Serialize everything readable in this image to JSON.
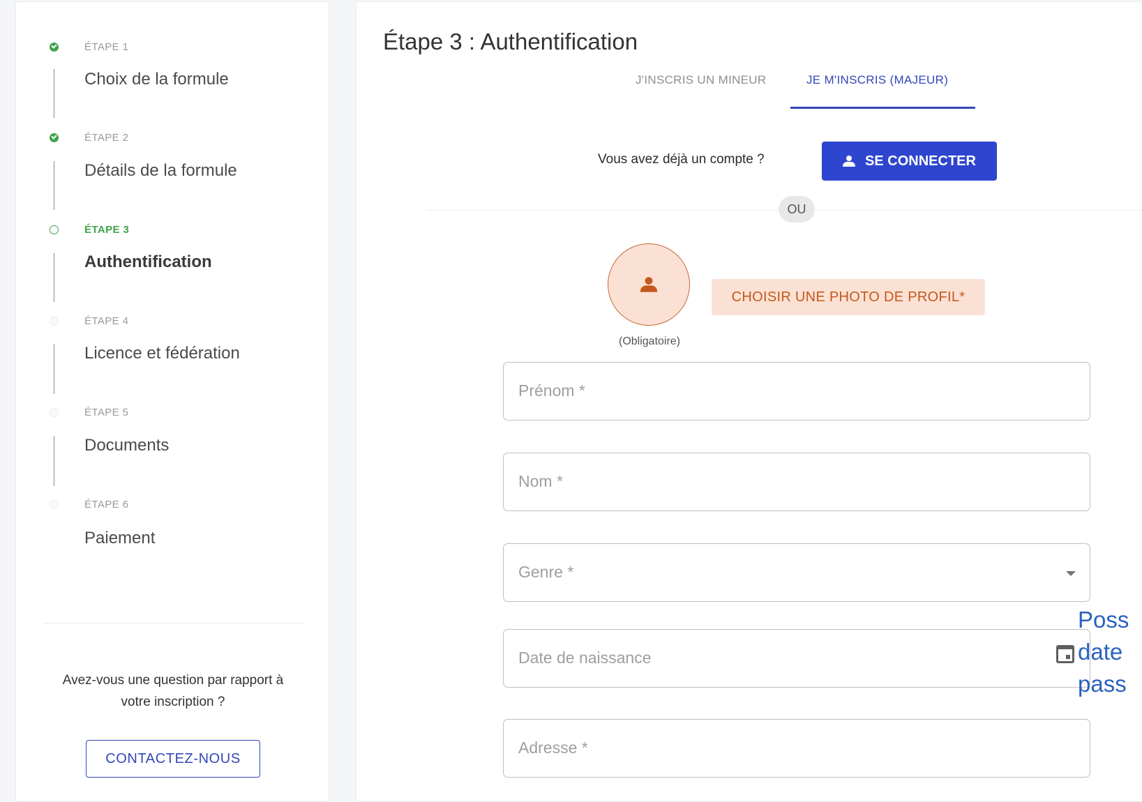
{
  "sidebar": {
    "steps": [
      {
        "label": "ÉTAPE 1",
        "title": "Choix de la formule",
        "status": "done"
      },
      {
        "label": "ÉTAPE 2",
        "title": "Détails de la formule",
        "status": "done"
      },
      {
        "label": "ÉTAPE 3",
        "title": "Authentification",
        "status": "active"
      },
      {
        "label": "ÉTAPE 4",
        "title": "Licence et fédération",
        "status": "todo"
      },
      {
        "label": "ÉTAPE 5",
        "title": "Documents",
        "status": "todo"
      },
      {
        "label": "ÉTAPE 6",
        "title": "Paiement",
        "status": "todo"
      }
    ],
    "question": "Avez-vous une question par rapport à votre inscription ?",
    "contact_label": "CONTACTEZ-NOUS"
  },
  "main": {
    "title": "Étape 3 : Authentification",
    "tabs": [
      {
        "label": "J'INSCRIS UN MINEUR",
        "selected": false
      },
      {
        "label": "JE M'INSCRIS (MAJEUR)",
        "selected": true
      }
    ],
    "account_question": "Vous avez déjà un compte ?",
    "login_label": "SE CONNECTER",
    "or_label": "OU",
    "photo_button_label": "CHOISIR UNE PHOTO DE PROFIL*",
    "photo_required": "(Obligatoire)",
    "fields": {
      "firstname": {
        "placeholder": "Prénom *",
        "value": ""
      },
      "lastname": {
        "placeholder": "Nom *",
        "value": ""
      },
      "gender": {
        "placeholder": "Genre *",
        "value": ""
      },
      "birthdate": {
        "placeholder": "Date de naissance",
        "value": ""
      },
      "address": {
        "placeholder": "Adresse *",
        "value": ""
      }
    }
  },
  "overlay_hint": {
    "line1": "Poss",
    "line2": "date",
    "line3": "pass"
  },
  "icons": {
    "login": "user-icon",
    "avatar": "user-icon",
    "birthdate": "calendar-icon",
    "gender": "caret-down-icon"
  },
  "colors": {
    "primary": "#2e45cf",
    "step_green": "#3fa34d",
    "photo_bg": "#fbe1d3",
    "photo_text": "#c4581e",
    "hint_blue": "#2a62bf"
  }
}
